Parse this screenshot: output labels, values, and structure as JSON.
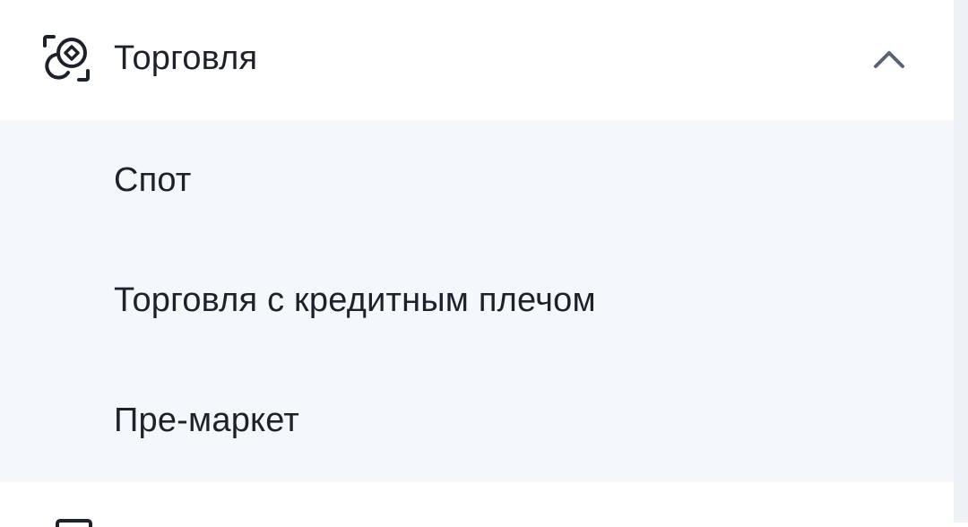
{
  "menu": {
    "section": {
      "title": "Торговля",
      "icon": "trade-target-icon",
      "expanded": true,
      "chevron_icon": "chevron-up-icon"
    },
    "items": [
      {
        "label": "Спот"
      },
      {
        "label": "Торговля с кредитным плечом"
      },
      {
        "label": "Пре-маркет"
      }
    ],
    "next_section_icon": "document-icon"
  },
  "colors": {
    "text": "#1d2129",
    "submenu_bg": "#f5f8fb",
    "chevron": "#5b6475",
    "icon": "#1d2129"
  }
}
